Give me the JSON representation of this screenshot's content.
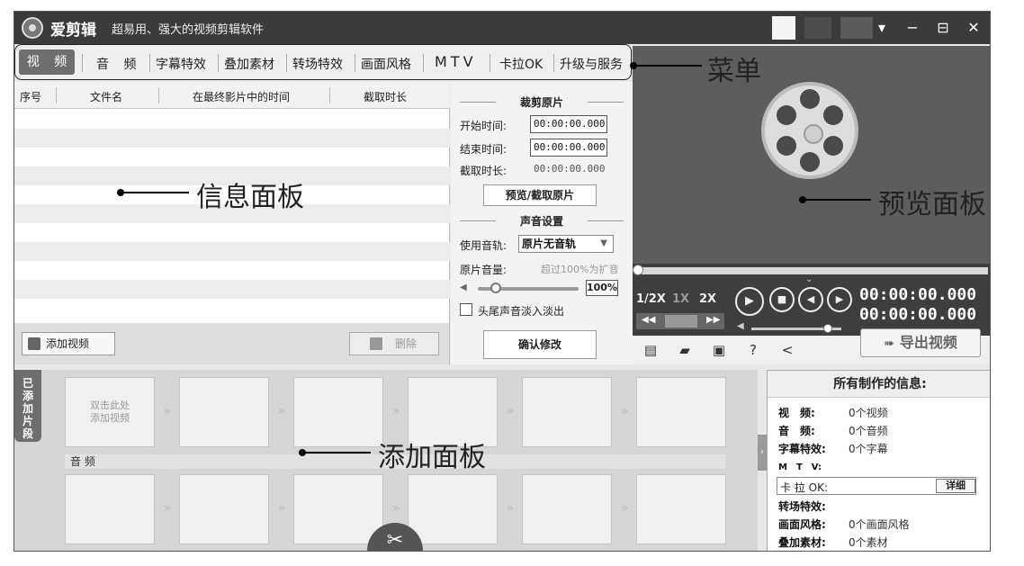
{
  "app": {
    "name": "爱剪辑",
    "slogan": "超易用、强大的视频剪辑软件"
  },
  "window_controls": {
    "dropdown": "▾",
    "minimize": "−",
    "maximize": "⊟",
    "close": "✕"
  },
  "menu": {
    "items": [
      "视 频",
      "音 频",
      "字幕特效",
      "叠加素材",
      "转场特效",
      "画面风格",
      "MTV",
      "卡拉OK",
      "升级与服务"
    ],
    "active_index": 0
  },
  "table": {
    "columns": [
      "序号",
      "文件名",
      "在最终影片中的时间",
      "截取时长"
    ],
    "rows": []
  },
  "buttons": {
    "add_video": "添加视频",
    "delete": "删除",
    "preview_trim": "预览/截取原片",
    "confirm": "确认修改",
    "export": "导出视频",
    "detail": "详细"
  },
  "trim": {
    "section_title": "裁剪原片",
    "start_label": "开始时间:",
    "start_value": "00:00:00.000",
    "end_label": "结束时间:",
    "end_value": "00:00:00.000",
    "duration_label": "截取时长:",
    "duration_value": "00:00:00.000"
  },
  "sound": {
    "section_title": "声音设置",
    "track_label": "使用音轨:",
    "track_value": "原片无音轨",
    "volume_label": "原片音量:",
    "volume_hint": "超过100%为扩音",
    "volume_value": "100%",
    "volume_level": 0.18,
    "fade_label": "头尾声音淡入淡出",
    "fade_checked": false
  },
  "player": {
    "speeds": [
      "1/2X",
      "1X",
      "2X"
    ],
    "active_speed": "1X",
    "timecode_current": "00:00:00.000",
    "timecode_total": "00:00:00.000",
    "progress": 0,
    "volume_level": 0.85
  },
  "clips": {
    "tab_label": "已添加片段",
    "placeholder": "双击此处\n添加视频",
    "audio_label": "音 频",
    "video_slots": 6,
    "audio_slots": 6
  },
  "info": {
    "title": "所有制作的信息:",
    "rows": [
      {
        "label": "视　频:",
        "value": "0个视频"
      },
      {
        "label": "音　频:",
        "value": "0个音频"
      },
      {
        "label": "字幕特效:",
        "value": "0个字幕"
      },
      {
        "label": "M　T　V:",
        "value": ""
      },
      {
        "label": "卡 拉 OK:",
        "value": ""
      },
      {
        "label": "转场特效:",
        "value": ""
      },
      {
        "label": "画面风格:",
        "value": "0个画面风格"
      },
      {
        "label": "叠加素材:",
        "value": "0个素材"
      }
    ]
  },
  "annotations": {
    "menu": "菜单",
    "info": "信息面板",
    "preview": "预览面板",
    "add": "添加面板"
  }
}
